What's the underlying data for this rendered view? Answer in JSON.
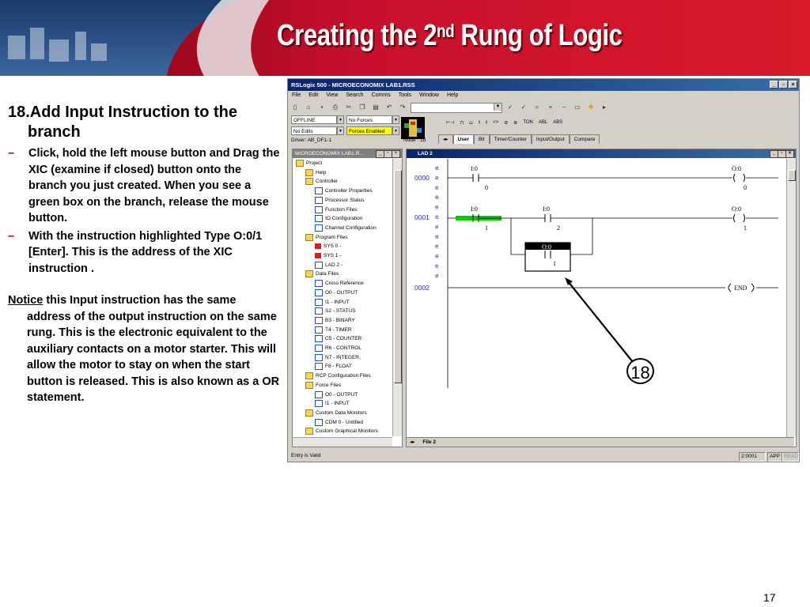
{
  "slide": {
    "title_main": "Creating the 2",
    "title_sup": "nd",
    "title_rest": " Rung of Logic",
    "step": "18.Add Input Instruction to the branch",
    "bullets": [
      "Click, hold the left mouse button and Drag the XIC (examine if closed) button onto the branch you just created. When you see a green box on the branch, release the mouse button.",
      "With the instruction highlighted Type O:0/1 [Enter]. This is the address of the XIC instruction ."
    ],
    "notice_word": "Notice",
    "notice_text": " this Input instruction has the same address of the output instruction on the same rung. This is the electronic equivalent to the auxiliary contacts on a motor starter. This will allow the motor to stay on when the start button is released. This is also known as a OR statement.",
    "page_number": "17",
    "callout": "18"
  },
  "window": {
    "title": "RSLogix 500 - MICROECONOMIX LAB1.RSS",
    "menu": [
      "File",
      "Edit",
      "View",
      "Search",
      "Comms",
      "Tools",
      "Window",
      "Help"
    ],
    "mode": "OFFLINE",
    "forces": "No Forces",
    "edits": "No Edits",
    "forces_enabled": "Forces Enabled",
    "driver": "Driver: AB_DF1-1",
    "node": "Node : 1d",
    "instr_labels": [
      "TON",
      "ABL",
      "ABS"
    ],
    "tabs": [
      "User",
      "Bit",
      "Timer/Counter",
      "Input/Output",
      "Compare"
    ],
    "status_left": "Entry is Valid",
    "status_pos": "2:0001",
    "status_app": "APP",
    "status_read": "READ"
  },
  "project": {
    "title": "MICROECONOMIX LAB1.R...",
    "items": [
      "Project",
      "Help",
      "Controller",
      "Controller Properties",
      "Processor Status",
      "Function Files",
      "IO Configuration",
      "Channel Configuration",
      "Program Files",
      "SYS 0 -",
      "SYS 1 -",
      "LAD 2 -",
      "Data Files",
      "Cross Reference",
      "O0 - OUTPUT",
      "I1 - INPUT",
      "S2 - STATUS",
      "B3 - BINARY",
      "T4 - TIMER",
      "C5 - COUNTER",
      "R6 - CONTROL",
      "N7 - INTEGER",
      "F8 - FLOAT",
      "RCP Configuration Files",
      "Force Files",
      "O0 - OUTPUT",
      "I1 - INPUT",
      "Custom Data Monitors",
      "CDM 0 - Untitled",
      "Custom Graphical Monitors"
    ]
  },
  "lad": {
    "title": "LAD 2",
    "file_tab": "File 2",
    "rung0": "0000",
    "rung1": "0001",
    "rung2": "0002",
    "e_marker": "e",
    "r0_in_addr": "I:0",
    "r0_in_bit": "0",
    "r0_out_addr": "O:0",
    "r0_out_bit": "0",
    "r1_in1_addr": "I:0",
    "r1_in1_bit": "1",
    "r1_in2_addr": "I:0",
    "r1_in2_bit": "2",
    "r1_out_addr": "O:0",
    "r1_out_bit": "1",
    "branch_addr": "O:0",
    "branch_bit": "1",
    "end_label": "END"
  },
  "colors": {
    "header_red": "#c8102e",
    "highlight_green": "#00d000",
    "window_blue": "#0a246a"
  }
}
